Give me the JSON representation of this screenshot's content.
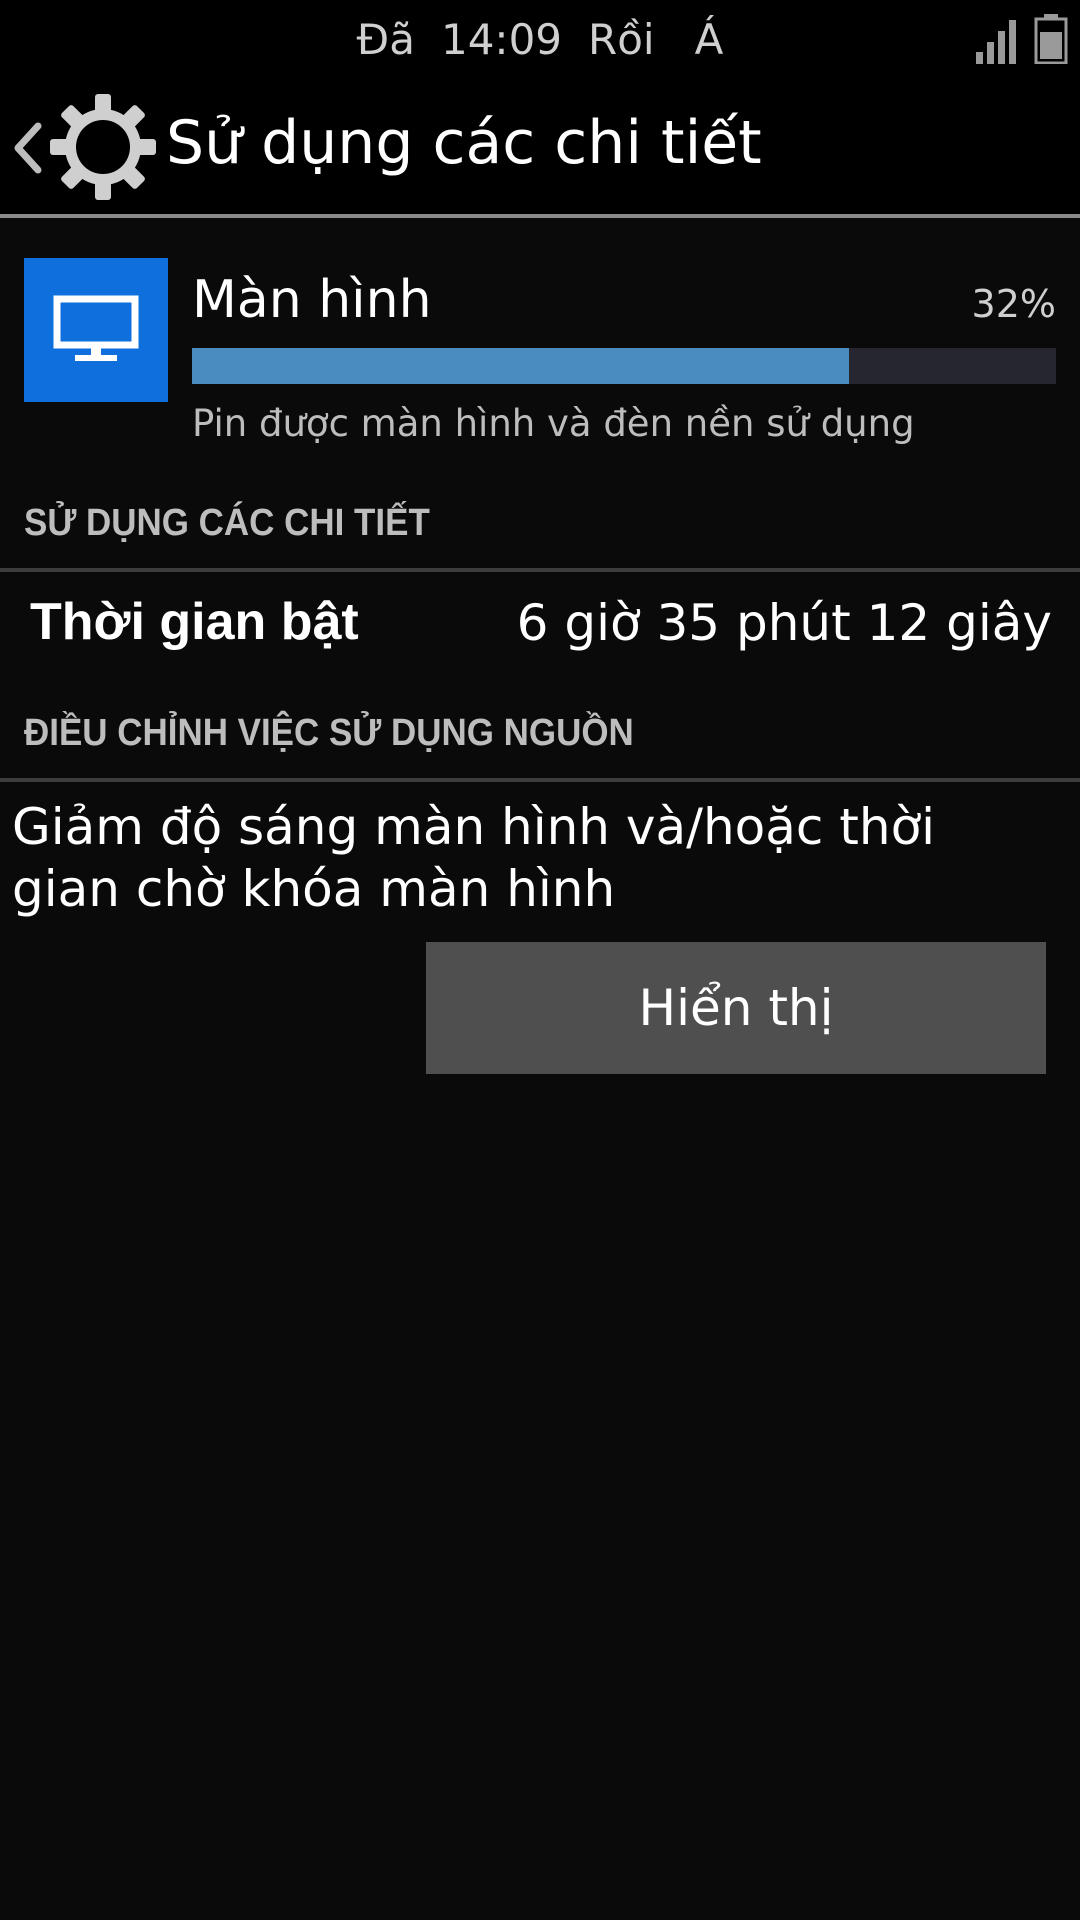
{
  "status_bar": {
    "text_1": "Đã",
    "time": "14:09",
    "text_2": "Rồi",
    "text_3": "Á",
    "icons": [
      "signal-icon",
      "battery-icon"
    ]
  },
  "header": {
    "title": "Sử dụng các chi tiết",
    "icons": [
      "back-icon",
      "gear-icon"
    ]
  },
  "usage_item": {
    "name": "Màn hình",
    "percent_label": "32%",
    "bar_fraction": 0.76,
    "description": "Pin được màn hình và đèn nền sử dụng",
    "icon": "monitor-icon",
    "tile_color": "#0e6fdd",
    "bar_color": "#4a8cc0"
  },
  "details_section": {
    "header": "SỬ DỤNG CÁC CHI TIẾT",
    "rows": [
      {
        "label": "Thời gian bật",
        "value": "6 giờ 35 phút 12 giây"
      }
    ]
  },
  "adjust_section": {
    "header": "ĐIỀU CHỈNH VIỆC SỬ DỤNG NGUỒN",
    "text": "Giảm độ sáng màn hình và/hoặc thời gian chờ khóa màn hình",
    "button_label": "Hiển thị"
  }
}
